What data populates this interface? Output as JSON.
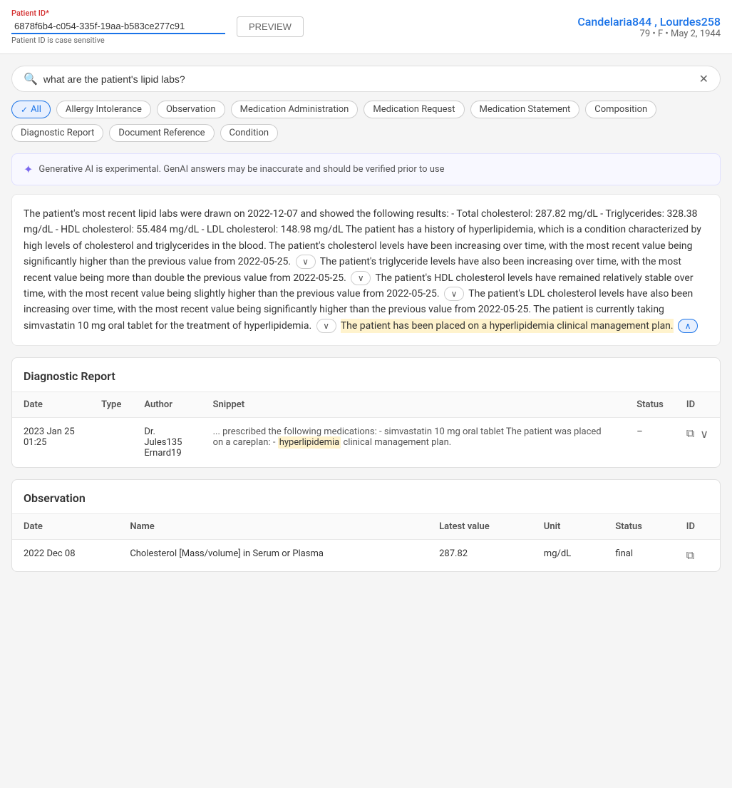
{
  "topBar": {
    "patientIdLabel": "Patient ID",
    "required": "*",
    "patientIdValue": "6878f6b4-c054-335f-19aa-b583ce277c91",
    "patientIdHint": "Patient ID is case sensitive",
    "previewLabel": "PREVIEW",
    "patientName": "Candelaria844 , Lourdes258",
    "patientDetails": "79 • F • May 2, 1944"
  },
  "search": {
    "placeholder": "what are the patient's lipid labs?",
    "value": "what are the patient's lipid labs?"
  },
  "filters": [
    {
      "id": "all",
      "label": "All",
      "active": true
    },
    {
      "id": "allergy",
      "label": "Allergy Intolerance",
      "active": false
    },
    {
      "id": "observation",
      "label": "Observation",
      "active": false
    },
    {
      "id": "medication-administration",
      "label": "Medication Administration",
      "active": false
    },
    {
      "id": "medication-request",
      "label": "Medication Request",
      "active": false
    },
    {
      "id": "medication-statement",
      "label": "Medication Statement",
      "active": false
    },
    {
      "id": "composition",
      "label": "Composition",
      "active": false
    },
    {
      "id": "diagnostic-report",
      "label": "Diagnostic Report",
      "active": false
    },
    {
      "id": "document-reference",
      "label": "Document Reference",
      "active": false
    },
    {
      "id": "condition",
      "label": "Condition",
      "active": false
    }
  ],
  "aiNotice": "Generative AI is experimental. GenAI answers may be inaccurate and should be verified prior to use",
  "responseText": {
    "paragraph1": "The patient's most recent lipid labs were drawn on 2022-12-07 and showed the following results: - Total cholesterol: 287.82 mg/dL - Triglycerides: 328.38 mg/dL - HDL cholesterol: 55.484 mg/dL - LDL cholesterol: 148.98 mg/dL The patient has a history of hyperlipidemia, which is a condition characterized by high levels of cholesterol and triglycerides in the blood. The patient's cholesterol levels have been increasing over time, with the most recent value being significantly higher than the previous value from 2022-05-25.",
    "paragraph2": "The patient's triglyceride levels have also been increasing over time, with the most recent value being more than double the previous value from 2022-05-25.",
    "paragraph3": "The patient's HDL cholesterol levels have remained relatively stable over time, with the most recent value being slightly higher than the previous value from 2022-05-25.",
    "paragraph4": "The patient's LDL cholesterol levels have also been increasing over time, with the most recent value being significantly higher than the previous value from 2022-05-25. The patient is currently taking simvastatin 10 mg oral tablet for the treatment of hyperlipidemia.",
    "highlighted": "The patient has been placed on a hyperlipidemia clinical management plan."
  },
  "diagnosticReport": {
    "title": "Diagnostic Report",
    "columns": [
      "Date",
      "Type",
      "Author",
      "Snippet",
      "Status",
      "ID"
    ],
    "rows": [
      {
        "date": "2023  Jan  25  01:25",
        "type": "",
        "author": "Dr. Jules135\nErnard19",
        "snippetPrefix": "... prescribed the following medications: - simvastatin 10 mg oral tablet The patient was placed on a careplan: -",
        "snippetHighlight": "hyperlipidemia",
        "snippetSuffix": " clinical management plan.",
        "status": "–",
        "id": ""
      }
    ]
  },
  "observation": {
    "title": "Observation",
    "columns": [
      "Date",
      "Name",
      "Latest value",
      "Unit",
      "Status",
      "ID"
    ],
    "rows": [
      {
        "date": "2022  Dec  08",
        "name": "Cholesterol [Mass/volume] in Serum or Plasma",
        "latestValue": "287.82",
        "unit": "mg/dL",
        "status": "final",
        "id": ""
      }
    ]
  }
}
